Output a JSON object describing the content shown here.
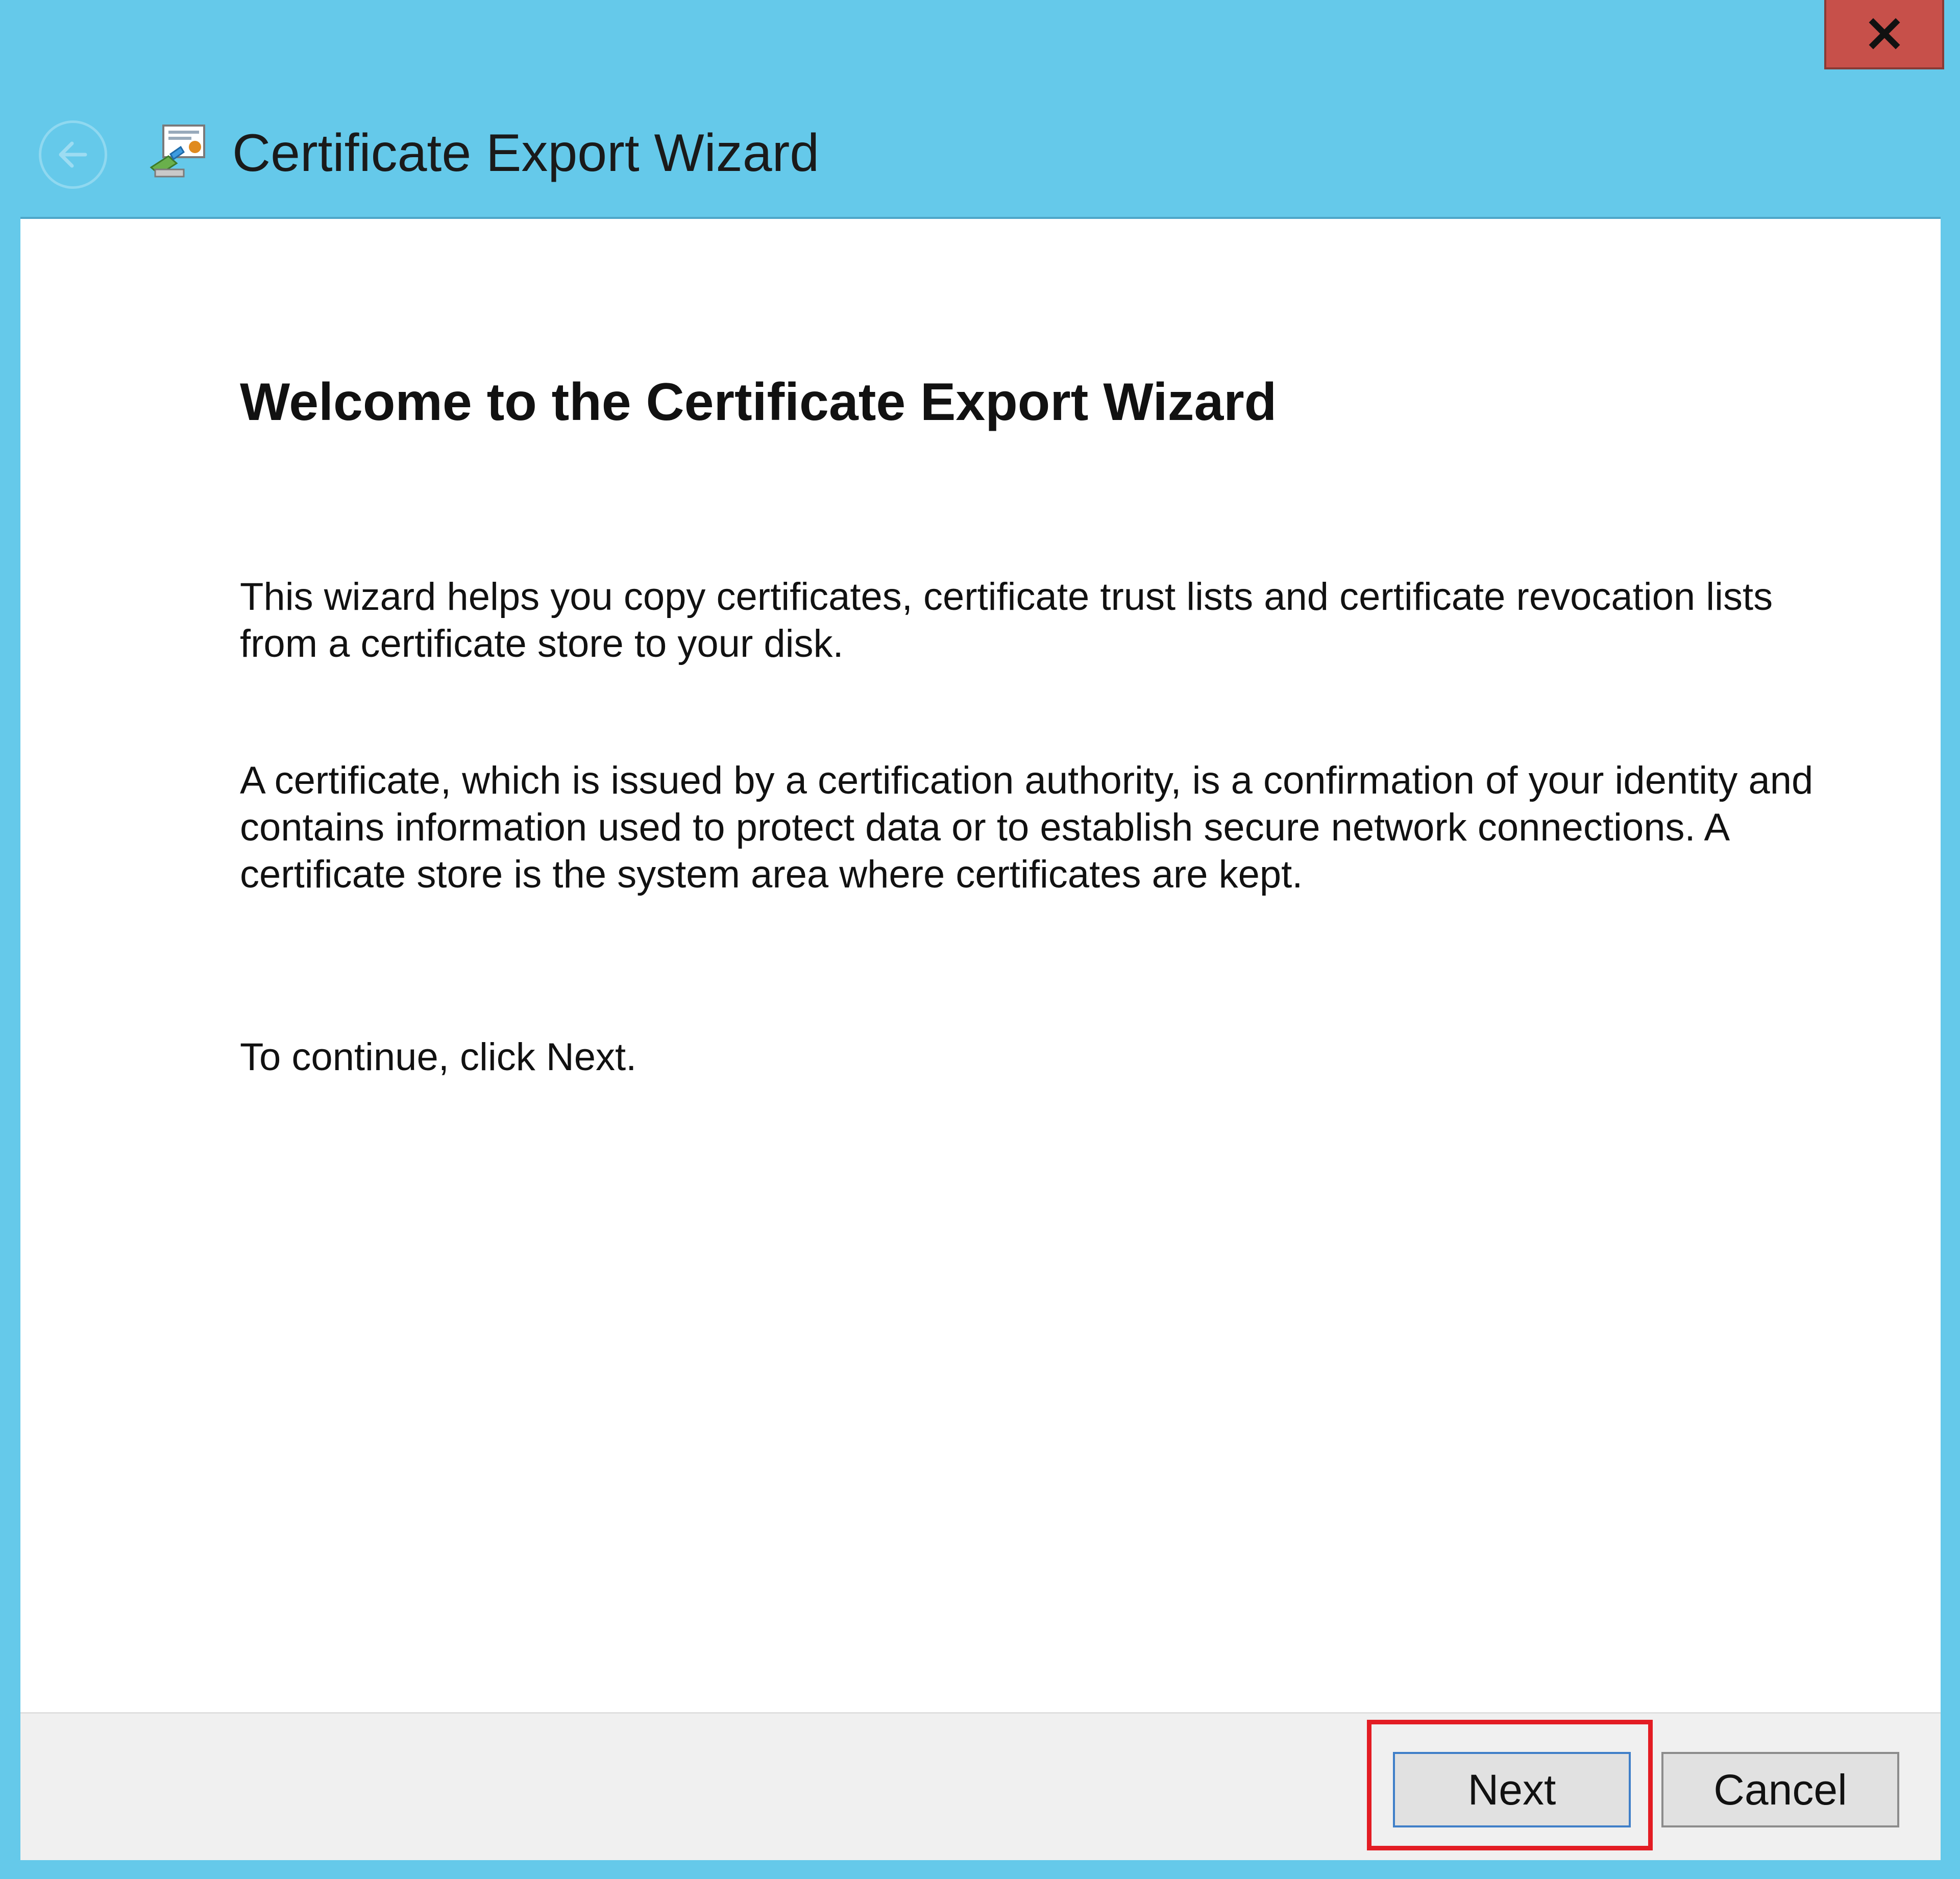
{
  "window": {
    "title": "Certificate Export Wizard",
    "close_label": "x"
  },
  "content": {
    "heading": "Welcome to the Certificate Export Wizard",
    "paragraph1": "This wizard helps you copy certificates, certificate trust lists and certificate revocation lists from a certificate store to your disk.",
    "paragraph2": "A certificate, which is issued by a certification authority, is a confirmation of your identity and contains information used to protect data or to establish secure network connections. A certificate store is the system area where certificates are kept.",
    "paragraph3": "To continue, click Next."
  },
  "footer": {
    "next_label": "Next",
    "cancel_label": "Cancel"
  },
  "colors": {
    "frame": "#65c9ea",
    "close": "#c7504a",
    "highlight": "#e31c23"
  },
  "icons": {
    "close": "close-icon",
    "back": "back-arrow-icon",
    "wizard": "certificate-wizard-icon"
  }
}
